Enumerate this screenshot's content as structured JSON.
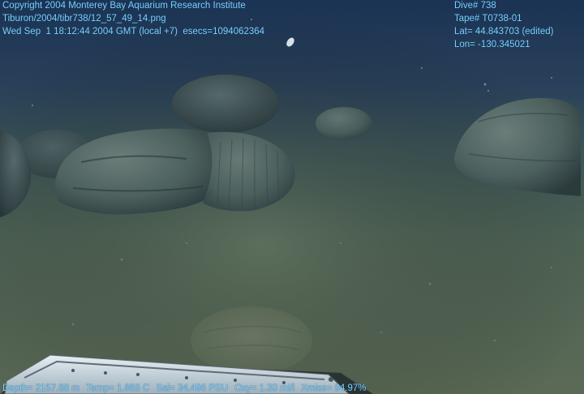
{
  "overlay": {
    "copyright": "Copyright 2004 Monterey Bay Aquarium Research Institute",
    "file_path": "Tiburon/2004/tibr738/12_57_49_14.png",
    "timestamp": "Wed Sep  1 18:12:44 2004 GMT (local +7)  esecs=1094062364",
    "dive": "Dive# 738",
    "tape": "Tape# T0738-01",
    "lat": "Lat= 44.843703 (edited)",
    "lon": "Lon= -130.345021",
    "depth": "Depth= 2157.88 m",
    "temp": "Temp= 1.869 C",
    "sal": "Sal= 34.496 PSU",
    "oxy": "Oxy= 1.30 ml/l",
    "xmiss": "Xmiss= 84.97%"
  },
  "colors": {
    "overlay_text": "#7fd0ff",
    "water_top": "#1b3354",
    "seafloor": "#556857",
    "pillow_lava": "#4a5e5c"
  }
}
